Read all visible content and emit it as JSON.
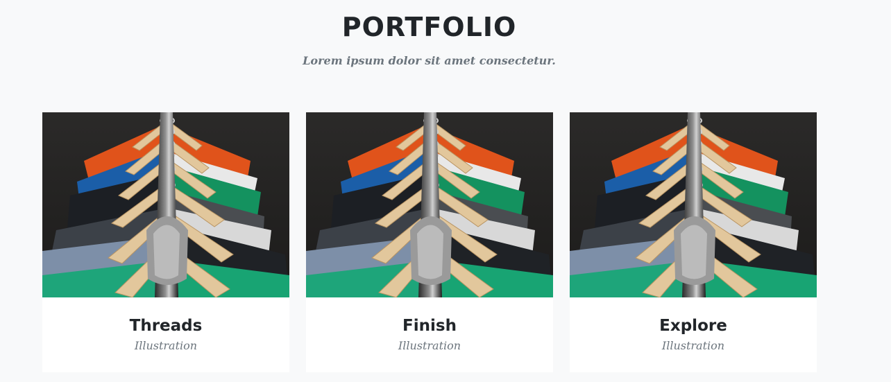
{
  "header": {
    "title": "PORTFOLIO",
    "subtitle": "Lorem ipsum dolor sit amet consectetur."
  },
  "portfolio": {
    "items": [
      {
        "title": "Threads",
        "category": "Illustration",
        "image": "clothes-hangers-photo"
      },
      {
        "title": "Finish",
        "category": "Illustration",
        "image": "clothes-hangers-photo"
      },
      {
        "title": "Explore",
        "category": "Illustration",
        "image": "clothes-hangers-photo"
      }
    ]
  }
}
